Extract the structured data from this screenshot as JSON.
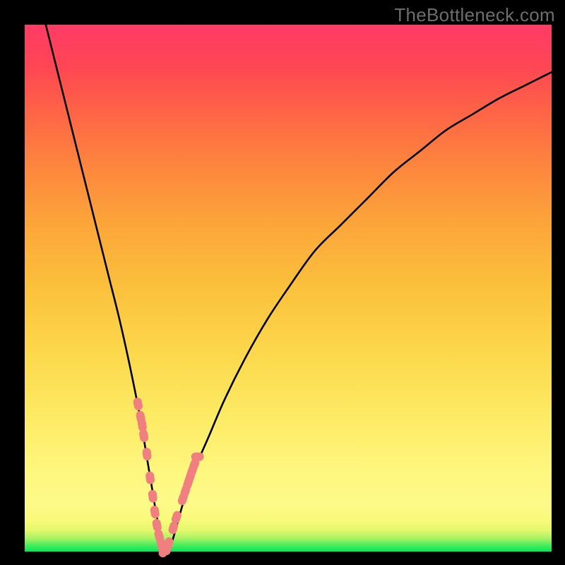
{
  "watermark": "TheBottleneck.com",
  "colors": {
    "frame": "#000000",
    "curve": "#000000",
    "dots": "#f08080",
    "gradient_top": "#ff3b66",
    "gradient_mid": "#fcd94d",
    "gradient_bottom": "#00e756"
  },
  "chart_data": {
    "type": "line",
    "title": "",
    "xlabel": "",
    "ylabel": "",
    "xlim": [
      0,
      100
    ],
    "ylim": [
      0,
      100
    ],
    "grid": false,
    "legend": false,
    "series": [
      {
        "name": "bottleneck-curve",
        "x": [
          4,
          6,
          8,
          10,
          12,
          14,
          16,
          18,
          20,
          22,
          23,
          24,
          25,
          26,
          27,
          28,
          30,
          32,
          35,
          38,
          42,
          46,
          50,
          55,
          60,
          65,
          70,
          75,
          80,
          85,
          90,
          95,
          100
        ],
        "y": [
          100,
          92,
          84,
          76,
          68,
          60,
          52,
          44,
          35,
          25,
          19,
          13,
          7,
          2,
          0,
          2,
          9,
          15,
          22,
          29,
          37,
          44,
          50,
          57,
          62,
          67,
          72,
          76,
          80,
          83,
          86,
          88.5,
          91
        ]
      }
    ],
    "highlight_points": {
      "name": "sample-dots",
      "x": [
        21.5,
        22,
        22.3,
        22.6,
        23.2,
        23.8,
        24.3,
        24.7,
        25.1,
        25.5,
        25.9,
        26.2,
        26.5,
        27.0,
        27.3,
        28.2,
        28.8,
        30.0,
        30.5,
        31.0,
        31.4,
        31.8,
        32.2,
        32.8
      ],
      "y": [
        28,
        25.5,
        24,
        22,
        18.5,
        14,
        10.5,
        7.5,
        5,
        3,
        1.5,
        0.5,
        0,
        0.5,
        1.5,
        4.5,
        6.5,
        10,
        11.5,
        13,
        14.2,
        15.4,
        16.5,
        18
      ]
    }
  }
}
